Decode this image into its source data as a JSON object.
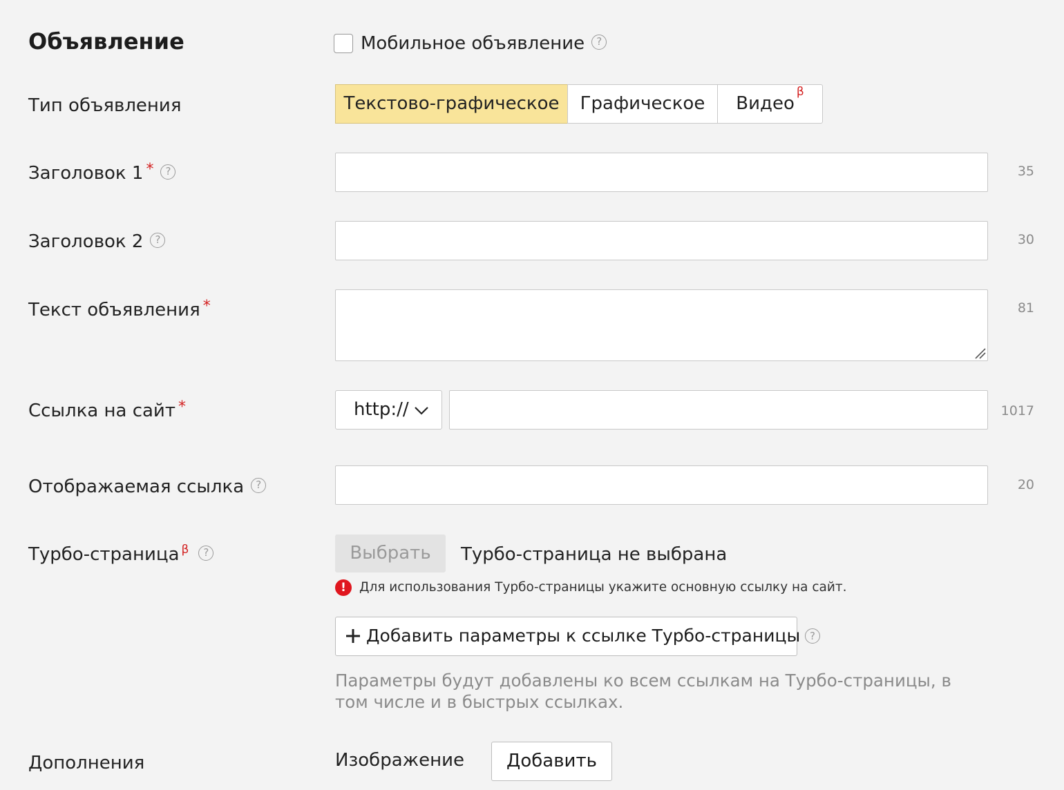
{
  "section": {
    "title": "Объявление",
    "mobile_checkbox_label": "Мобильное объявление",
    "mobile_checked": false
  },
  "ad_type": {
    "label": "Тип объявления",
    "options": [
      "Текстово-графическое",
      "Графическое",
      "Видео"
    ],
    "selected": "Текстово-графическое",
    "beta_mark": "β"
  },
  "headline1": {
    "label": "Заголовок 1",
    "required_mark": "*",
    "value": "",
    "counter": "35"
  },
  "headline2": {
    "label": "Заголовок 2",
    "value": "",
    "counter": "30"
  },
  "ad_text": {
    "label": "Текст объявления",
    "required_mark": "*",
    "value": "",
    "counter": "81"
  },
  "site_link": {
    "label": "Ссылка на сайт",
    "required_mark": "*",
    "protocol": "http://",
    "value": "",
    "counter": "1017"
  },
  "display_link": {
    "label": "Отображаемая ссылка",
    "value": "",
    "counter": "20"
  },
  "turbo": {
    "label": "Турбо-страница",
    "beta_mark": "β",
    "choose_button": "Выбрать",
    "status": "Турбо-страница не выбрана",
    "error_text": "Для использования Турбо-страницы укажите основную ссылку на сайт.",
    "add_params_button": "Добавить параметры к ссылке Турбо-страницы",
    "params_note": "Параметры будут добавлены ко всем ссылкам на Турбо-страницы, в том числе и в быстрых ссылках."
  },
  "extras": {
    "label": "Дополнения",
    "image_label": "Изображение",
    "add_button": "Добавить"
  },
  "icons": {
    "help": "question-circle-icon",
    "dropdown": "chevron-down-icon",
    "error": "exclamation-circle-icon",
    "plus": "plus-icon",
    "resize": "resize-handle-icon"
  },
  "colors": {
    "background": "#f3f3f3",
    "active_segment": "#f9e49a",
    "required": "#d32020",
    "error": "#e0161e",
    "muted_text": "#8a8a8a"
  }
}
